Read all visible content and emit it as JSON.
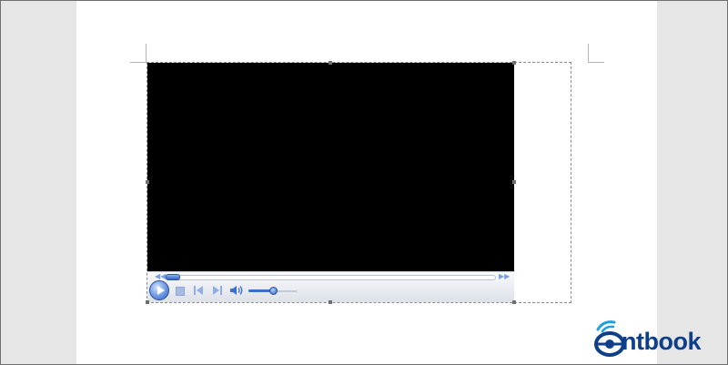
{
  "colors": {
    "background": "#e6e6e6",
    "page": "#ffffff",
    "video": "#000000",
    "accent": "#2a5fc2",
    "logo": "#0f3f8a"
  },
  "player": {
    "seek_position": 0.03,
    "volume_level": 0.48,
    "icons": [
      "seek-rewind-icon",
      "seek-forward-icon",
      "play-icon",
      "stop-icon",
      "previous-icon",
      "next-icon",
      "volume-icon"
    ]
  },
  "watermark": {
    "text": "ntbook",
    "icon": "eye-logo-icon"
  }
}
